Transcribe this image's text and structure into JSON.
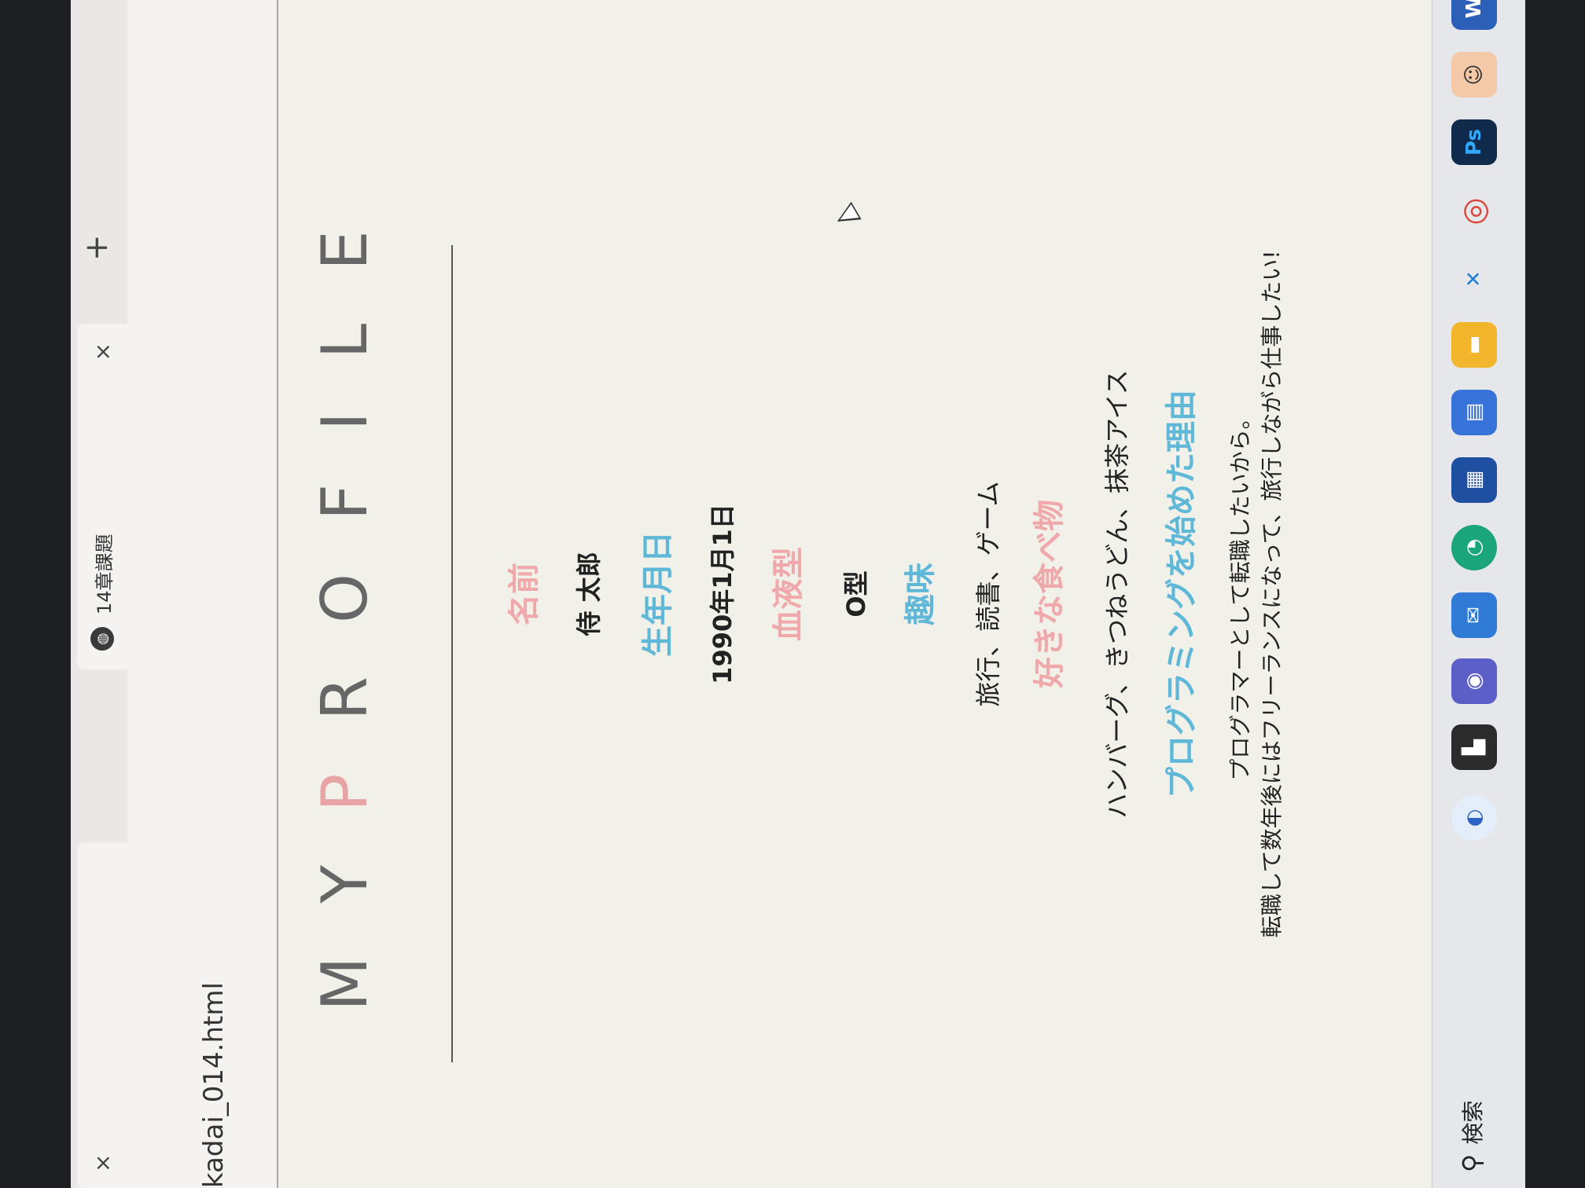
{
  "browser": {
    "tab_title": "14章課題",
    "tab_close": "×",
    "new_tab": "+",
    "url": "kadai_014.html"
  },
  "page": {
    "heading_letters": [
      "M",
      "Y",
      "P",
      "R",
      "O",
      "F",
      "I",
      "L",
      "E"
    ],
    "name_label": "名前",
    "name_value": "侍 太郎",
    "birthday_label": "生年月日",
    "birthday_value": "1990年1月1日",
    "blood_label": "血液型",
    "blood_value": "O型",
    "hobby_label": "趣味",
    "hobby_value": "旅行、読書、ゲーム",
    "food_label": "好きな食べ物",
    "food_value": "ハンバーグ、きつねうどん、抹茶アイス",
    "reason_label": "プログラミングを始めた理由",
    "reason_line1": "プログラマーとして転職したいから。",
    "reason_line2": "転職して数年後にはフリーランスになって、旅行しながら仕事したい!"
  },
  "taskbar": {
    "search_label": "検索",
    "icons": [
      "copilot-icon",
      "file-explorer-icon",
      "teams-icon",
      "mail-icon",
      "edge-icon",
      "store-icon",
      "widgets-icon",
      "folder-icon",
      "vscode-icon",
      "chrome-icon",
      "photoshop-icon",
      "avatar-app-icon",
      "word-icon"
    ]
  },
  "colors": {
    "pink": "#f0a9ab",
    "blue": "#5fb8d8",
    "page_bg": "#f1f0e9"
  }
}
